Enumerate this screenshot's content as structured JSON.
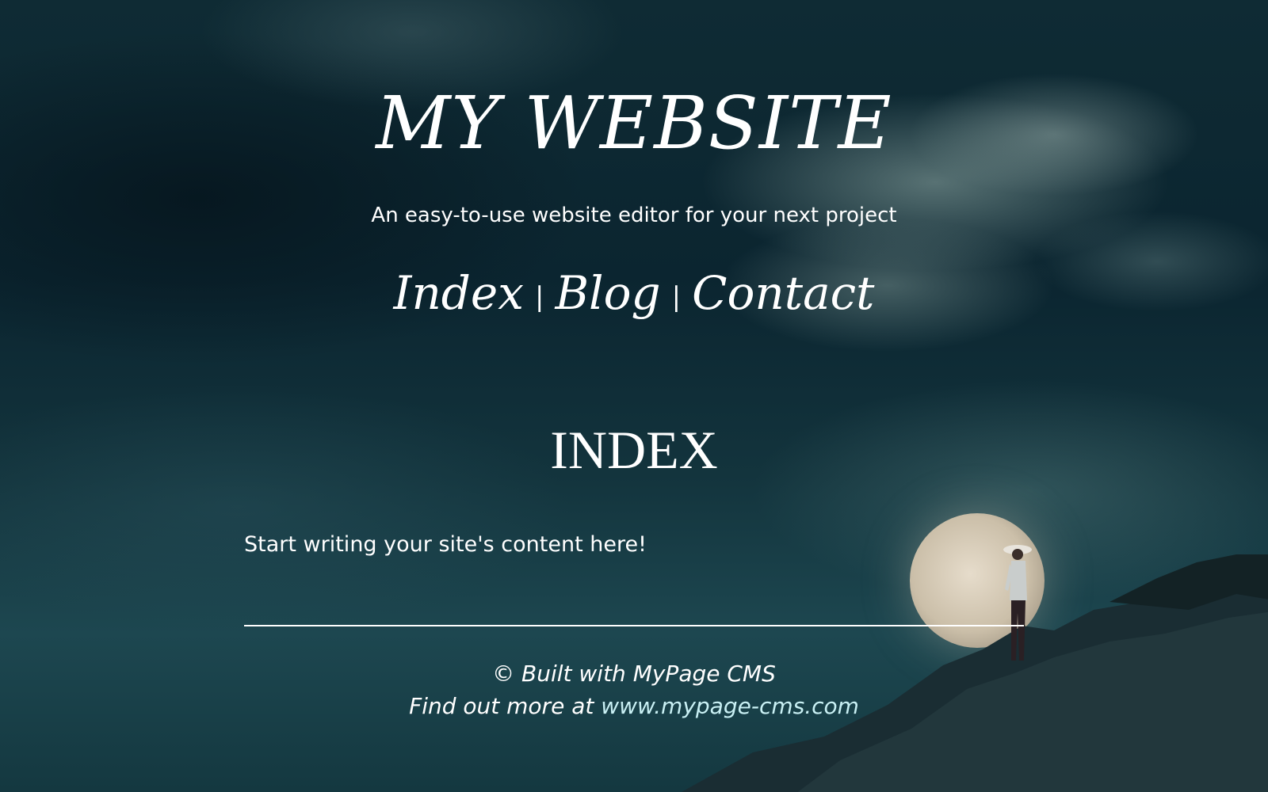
{
  "site": {
    "title": "MY WEBSITE",
    "tagline": "An easy-to-use website editor for your next project"
  },
  "nav": {
    "items": [
      {
        "label": "Index"
      },
      {
        "label": "Blog"
      },
      {
        "label": "Contact"
      }
    ],
    "separator": "|"
  },
  "main": {
    "heading": "INDEX",
    "content": "Start writing your site's content here!"
  },
  "footer": {
    "credit": "© Built with MyPage CMS",
    "find_more_prefix": "Find out more at ",
    "link_text": "www.mypage-cms.com"
  },
  "colors": {
    "text": "#ffffff",
    "link": "#c9f0f4",
    "background": "#0d2a33"
  }
}
